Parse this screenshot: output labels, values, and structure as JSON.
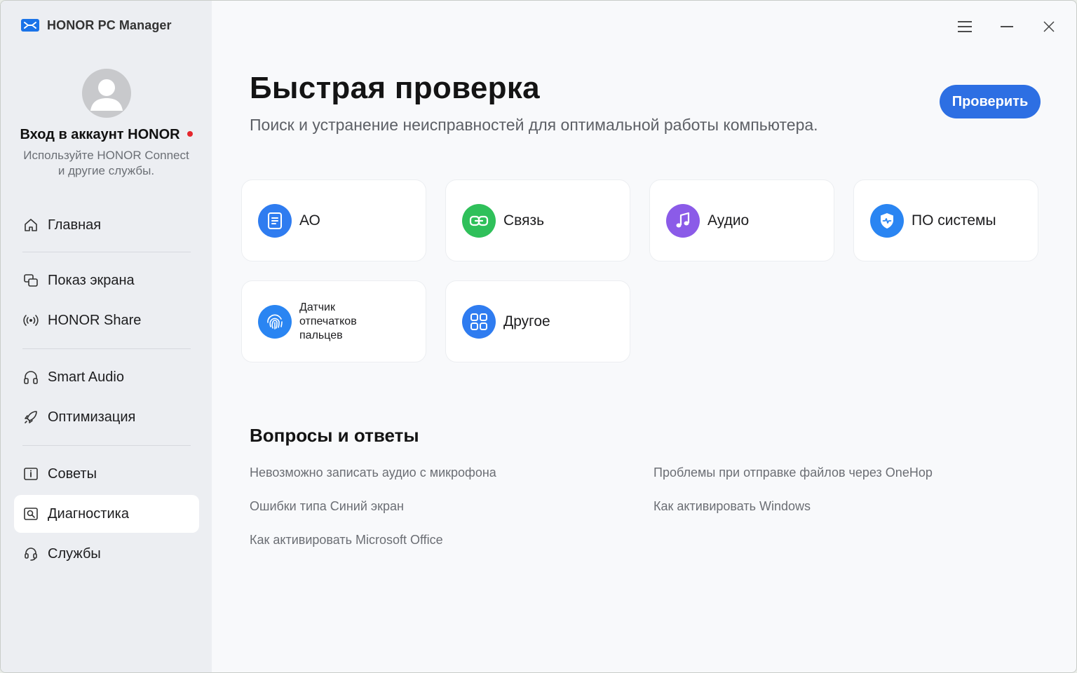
{
  "app": {
    "title": "HONOR PC Manager"
  },
  "account": {
    "title": "Вход в аккаунт HONOR",
    "subtitle_line1": "Используйте HONOR Connect",
    "subtitle_line2": "и другие службы."
  },
  "sidebar": {
    "items": [
      {
        "label": "Главная",
        "icon": "home-icon"
      },
      {
        "label": "Показ экрана",
        "icon": "screen-mirror-icon"
      },
      {
        "label": "HONOR Share",
        "icon": "share-wireless-icon"
      },
      {
        "label": "Smart Audio",
        "icon": "headphones-icon"
      },
      {
        "label": "Оптимизация",
        "icon": "rocket-icon"
      },
      {
        "label": "Советы",
        "icon": "tips-icon"
      },
      {
        "label": "Диагностика",
        "icon": "diagnostics-icon",
        "active": true
      },
      {
        "label": "Службы",
        "icon": "support-headset-icon"
      }
    ]
  },
  "main": {
    "title": "Быстрая проверка",
    "subtitle": "Поиск и устранение неисправностей для оптимальной работы компьютера.",
    "check_button": "Проверить",
    "cards": [
      {
        "label": "АО",
        "icon": "document-icon",
        "color": "#2f7cf0"
      },
      {
        "label": "Связь",
        "icon": "link-icon",
        "color": "#2fc05a"
      },
      {
        "label": "Аудио",
        "icon": "music-note-icon",
        "color": "#8b5be8"
      },
      {
        "label": "ПО системы",
        "icon": "shield-icon",
        "color": "#2a85f2"
      },
      {
        "label": "Датчик отпечатков пальцев",
        "icon": "fingerprint-icon",
        "color": "#2a85f2"
      },
      {
        "label": "Другое",
        "icon": "grid-icon",
        "color": "#2f7cf0"
      }
    ],
    "faq": {
      "title": "Вопросы и ответы",
      "links": [
        "Невозможно записать аудио с микрофона",
        "Проблемы при отправке файлов через OneHop",
        "Ошибки типа Синий экран",
        "Как активировать Windows",
        "Как активировать Microsoft Office"
      ]
    }
  },
  "colors": {
    "accent": "#2d6fe3",
    "notification": "#e5262d"
  }
}
